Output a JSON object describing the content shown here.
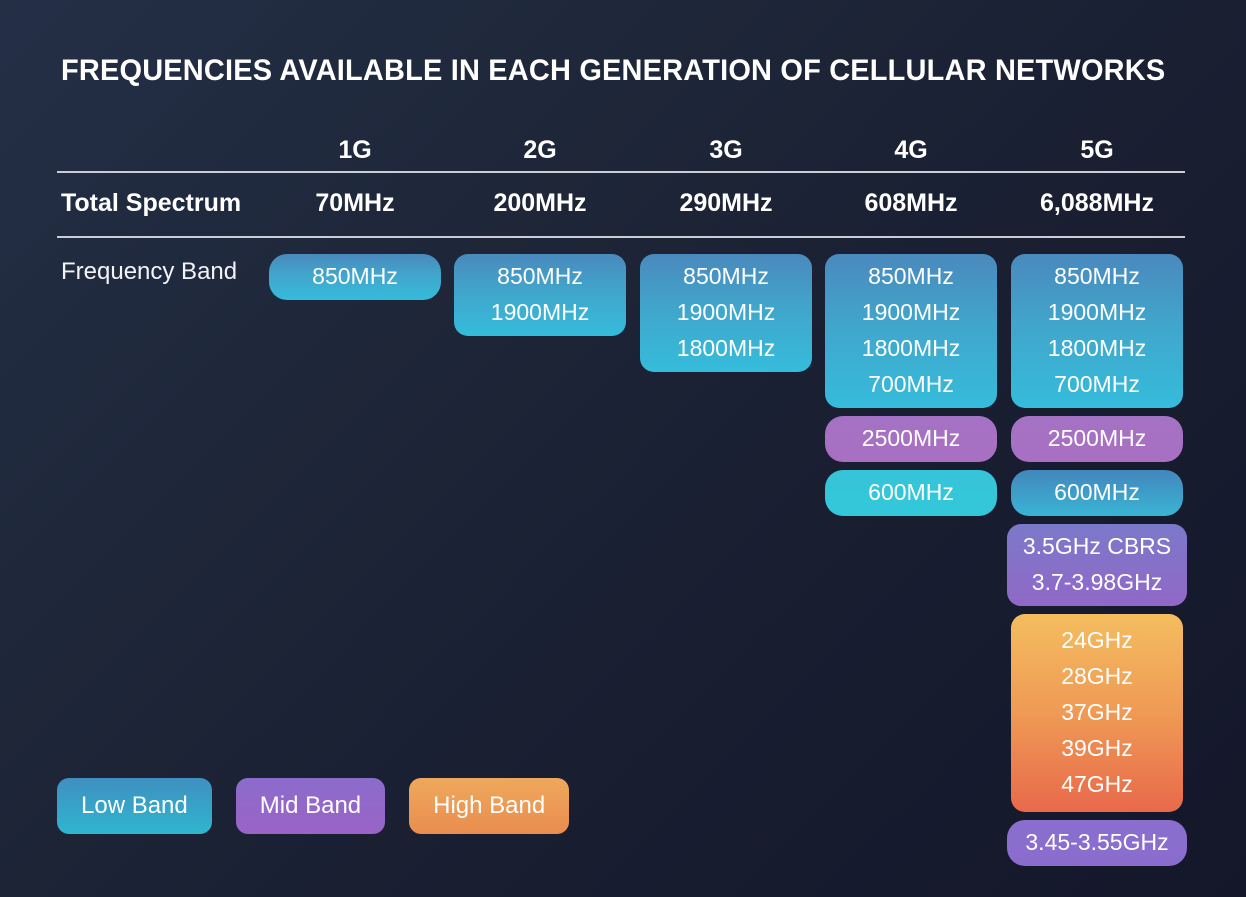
{
  "title": "FREQUENCIES AVAILABLE IN EACH GENERATION OF CELLULAR NETWORKS",
  "row_labels": {
    "total_spectrum": "Total Spectrum",
    "frequency_band": "Frequency Band"
  },
  "generations": [
    {
      "name": "1G",
      "total_spectrum": "70MHz"
    },
    {
      "name": "2G",
      "total_spectrum": "200MHz"
    },
    {
      "name": "3G",
      "total_spectrum": "290MHz"
    },
    {
      "name": "4G",
      "total_spectrum": "608MHz"
    },
    {
      "name": "5G",
      "total_spectrum": "6,088MHz"
    }
  ],
  "frequency_bands": {
    "1G": [
      {
        "band": "low",
        "values": [
          "850MHz"
        ]
      }
    ],
    "2G": [
      {
        "band": "low",
        "values": [
          "850MHz",
          "1900MHz"
        ]
      }
    ],
    "3G": [
      {
        "band": "low",
        "values": [
          "850MHz",
          "1900MHz",
          "1800MHz"
        ]
      }
    ],
    "4G": [
      {
        "band": "low",
        "values": [
          "850MHz",
          "1900MHz",
          "1800MHz",
          "700MHz"
        ]
      },
      {
        "band": "mid",
        "values": [
          "2500MHz"
        ]
      },
      {
        "band": "low",
        "values": [
          "600MHz"
        ]
      }
    ],
    "5G": [
      {
        "band": "low",
        "values": [
          "850MHz",
          "1900MHz",
          "1800MHz",
          "700MHz"
        ]
      },
      {
        "band": "mid",
        "values": [
          "2500MHz"
        ]
      },
      {
        "band": "low",
        "values": [
          "600MHz"
        ]
      },
      {
        "band": "mid",
        "values": [
          "3.5GHz CBRS",
          "3.7-3.98GHz"
        ]
      },
      {
        "band": "high",
        "values": [
          "24GHz",
          "28GHz",
          "37GHz",
          "39GHz",
          "47GHz"
        ]
      },
      {
        "band": "mid",
        "values": [
          "3.45-3.55GHz"
        ]
      }
    ]
  },
  "legend": [
    {
      "label": "Low Band",
      "color": "#35a8cb"
    },
    {
      "label": "Mid Band",
      "color": "#9266c9"
    },
    {
      "label": "High Band",
      "color": "#ec9853"
    }
  ],
  "colors": {
    "background_from": "#242f47",
    "background_to": "#14172a",
    "rule": "#c8cdd8",
    "text": "#ffffff",
    "low_band_top": "#4a89bd",
    "low_band_bottom": "#35bcdb",
    "mid_band_top": "#7b79c9",
    "mid_band_bottom": "#9168c8",
    "high_band_top": "#f4bd5f",
    "high_band_bottom": "#e8694b"
  }
}
